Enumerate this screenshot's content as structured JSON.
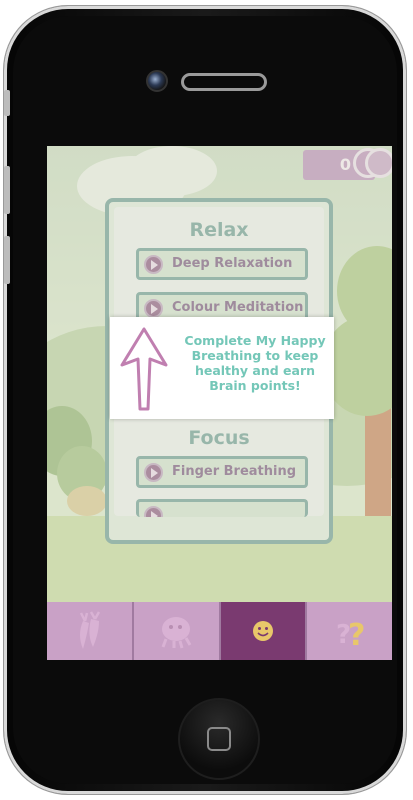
{
  "score": {
    "value": "0"
  },
  "menu": {
    "sections": [
      {
        "title": "Relax"
      },
      {
        "title": "Focus"
      }
    ],
    "buttons": [
      {
        "label": "Deep Relaxation"
      },
      {
        "label": "Colour Meditation"
      },
      {
        "label": "Finger Breathing"
      }
    ]
  },
  "tooltip": {
    "lines": [
      "Complete My Happy",
      "Breathing to keep",
      "healthy and earn",
      "Brain points!"
    ]
  },
  "tabbar": {
    "tabs": [
      {
        "icon": "carrots-icon",
        "active": false
      },
      {
        "icon": "character-icon",
        "active": false
      },
      {
        "icon": "smiley-icon",
        "active": true
      },
      {
        "icon": "question-icon",
        "active": false
      }
    ]
  },
  "colors": {
    "accent_green": "#6b9c8e",
    "purple": "#76567a",
    "tab_active": "#7a3a70",
    "tab_bg": "#c9a1c6",
    "tooltip_text": "#74c7b8"
  }
}
